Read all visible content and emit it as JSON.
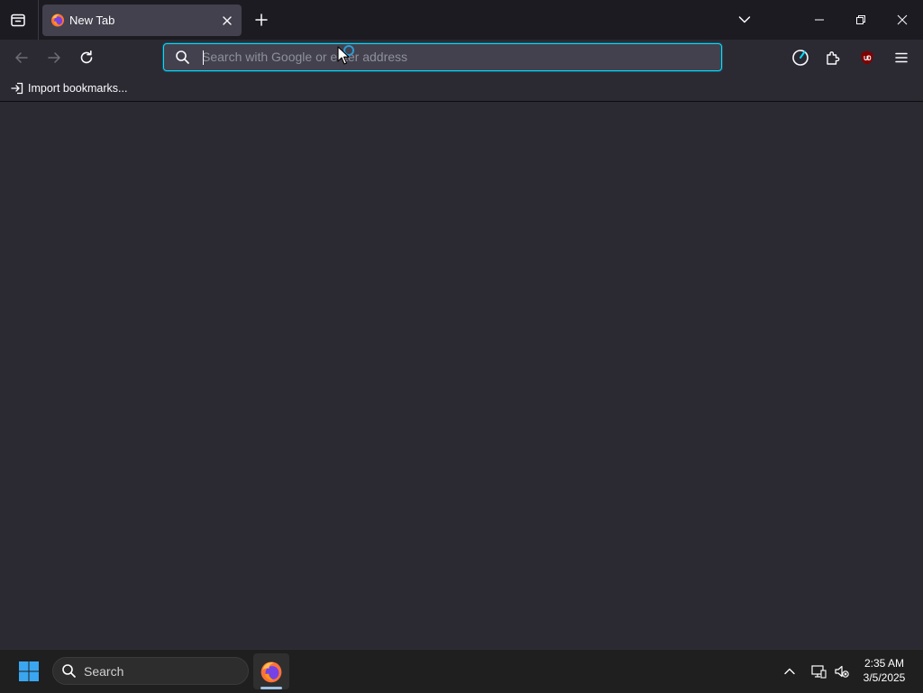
{
  "tab": {
    "title": "New Tab"
  },
  "urlbar": {
    "placeholder": "Search with Google or enter address",
    "value": ""
  },
  "bookmarks": {
    "import_label": "Import bookmarks..."
  },
  "taskbar": {
    "search_label": "Search",
    "time": "2:35 AM",
    "date": "3/5/2025"
  },
  "colors": {
    "accent": "#00ddff",
    "chrome": "#2b2a33",
    "tabstrip": "#1c1b22",
    "taskbar": "#1f1f1f"
  },
  "icons": {
    "tab_list": "tab-list-icon",
    "firefox": "firefox-icon",
    "close": "close-icon",
    "new_tab": "plus-icon",
    "overflow": "chevron-down-icon",
    "minimize": "minimize-icon",
    "restore": "restore-icon",
    "window_close": "close-icon",
    "back": "arrow-left-icon",
    "forward": "arrow-right-icon",
    "reload": "reload-icon",
    "search": "search-icon",
    "pocket": "pie-icon",
    "extensions": "puzzle-icon",
    "ublock": "shield-icon",
    "menu": "hamburger-icon",
    "import": "import-icon",
    "windows": "windows-logo-icon",
    "tray_up": "chevron-up-icon",
    "network": "network-icon",
    "sound": "speaker-muted-icon"
  }
}
